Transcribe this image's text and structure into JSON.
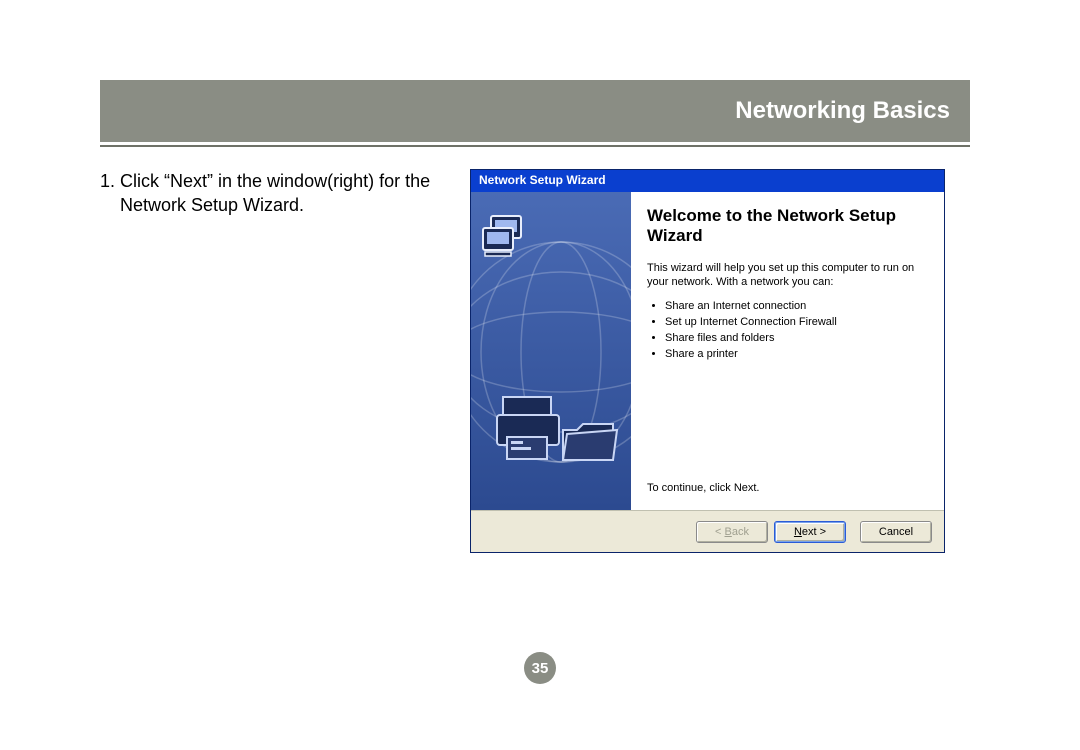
{
  "header": {
    "title": "Networking Basics"
  },
  "instruction": {
    "text": "1. Click “Next” in the window(right) for the Network Setup Wizard."
  },
  "wizard": {
    "titlebar": "Network Setup Wizard",
    "heading": "Welcome to the Network Setup Wizard",
    "intro": "This wizard will help you set up this computer to run on your network. With a network you can:",
    "bullets": [
      "Share an Internet connection",
      "Set up Internet Connection Firewall",
      "Share files and folders",
      "Share a printer"
    ],
    "continue_text": "To continue, click Next.",
    "buttons": {
      "back_prefix": "< ",
      "back_u": "B",
      "back_rest": "ack",
      "next_u": "N",
      "next_rest": "ext >",
      "cancel": "Cancel"
    }
  },
  "page_number": "35"
}
